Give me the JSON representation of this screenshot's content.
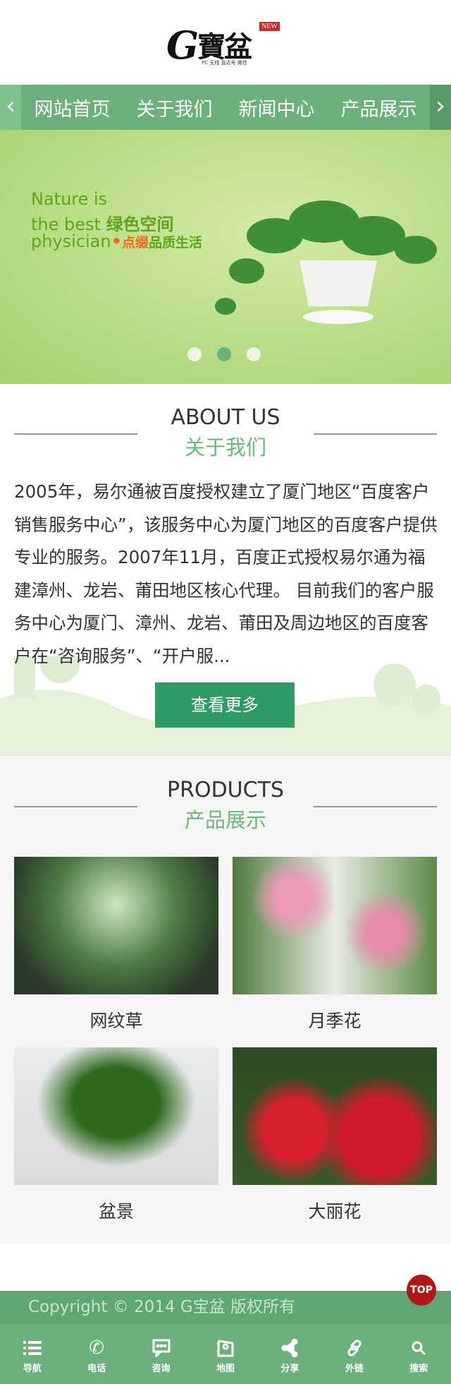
{
  "logo": {
    "letter": "G",
    "text": "寶盆",
    "badge": "NEW",
    "tagline": "PC 无线 直达号 微信"
  },
  "nav": {
    "prev": "‹",
    "next": "›",
    "items": [
      "网站首页",
      "关于我们",
      "新闻中心",
      "产品展示"
    ]
  },
  "banner": {
    "line1": "Nature is",
    "line2_en": "the best ",
    "line2_zh": "绿色空间",
    "line3_en": "physician",
    "line3_dot": "•",
    "line3_orange": "点缀",
    "line3_green": "品质生活",
    "slides": 3,
    "active_slide": 2
  },
  "about": {
    "title_en": "ABOUT US",
    "title_zh": "关于我们",
    "text": "2005年，易尔通被百度授权建立了厦门地区“百度客户销售服务中心”，该服务中心为厦门地区的百度客户提供专业的服务。2007年11月，百度正式授权易尔通为福建漳州、龙岩、莆田地区核心代理。 目前我们的客户服务中心为厦门、漳州、龙岩、莆田及周边地区的百度客户在“咨询服务”、“开户服...",
    "more_label": "查看更多"
  },
  "products": {
    "title_en": "PRODUCTS",
    "title_zh": "产品展示",
    "items": [
      {
        "name": "网纹草"
      },
      {
        "name": "月季花"
      },
      {
        "name": "盆景"
      },
      {
        "name": "大丽花"
      }
    ]
  },
  "footer": {
    "copyright": "Copyright © 2014 G宝盆 版权所有",
    "top_label": "TOP",
    "nav": [
      {
        "label": "导航",
        "icon": "list-icon"
      },
      {
        "label": "电话",
        "icon": "phone-icon"
      },
      {
        "label": "咨询",
        "icon": "chat-icon"
      },
      {
        "label": "地图",
        "icon": "map-icon"
      },
      {
        "label": "分享",
        "icon": "share-icon"
      },
      {
        "label": "外链",
        "icon": "link-icon"
      },
      {
        "label": "搜索",
        "icon": "search-icon"
      }
    ]
  },
  "colors": {
    "primary": "#6cb07e",
    "button": "#2f9b64",
    "top": "#b01818"
  }
}
